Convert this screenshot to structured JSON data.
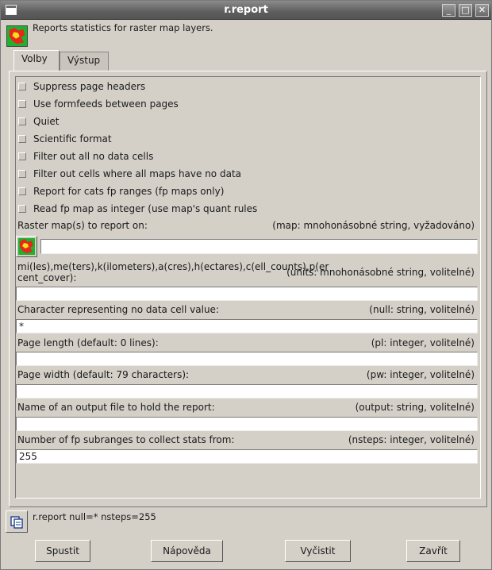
{
  "window": {
    "title": "r.report"
  },
  "header": {
    "description": "Reports statistics for raster map layers."
  },
  "tabs": [
    {
      "label": "Volby"
    },
    {
      "label": "Výstup"
    }
  ],
  "flags": [
    {
      "label": "Suppress page headers"
    },
    {
      "label": "Use formfeeds between pages"
    },
    {
      "label": "Quiet"
    },
    {
      "label": "Scientific format"
    },
    {
      "label": "Filter out all no data cells"
    },
    {
      "label": "Filter out cells where all maps have no data"
    },
    {
      "label": "Report for cats fp ranges (fp maps only)"
    },
    {
      "label": "Read fp map as integer (use map's quant rules"
    }
  ],
  "options": {
    "map": {
      "label": "Raster map(s) to report on:",
      "hint": "(map: mnohonásobné string, vyžadováno)",
      "value": ""
    },
    "units": {
      "label_line1": "mi(les),me(ters),k(ilometers),a(cres),h(ectares),c(ell_counts),p(er",
      "label_line2": "cent_cover):",
      "hint": "(units: mnohonásobné string, volitelné)",
      "value": ""
    },
    "null": {
      "label": "Character representing no data cell value:",
      "hint": "(null:  string, volitelné)",
      "value": "*"
    },
    "pl": {
      "label": "Page length (default: 0 lines):",
      "hint": "(pl:  integer, volitelné)",
      "value": ""
    },
    "pw": {
      "label": "Page width (default: 79 characters):",
      "hint": "(pw:  integer, volitelné)",
      "value": ""
    },
    "output": {
      "label": "Name of an output file to hold the report:",
      "hint": "(output:  string, volitelné)",
      "value": ""
    },
    "nsteps": {
      "label": "Number of fp subranges to collect stats from:",
      "hint": "(nsteps:  integer, volitelné)",
      "value": "255"
    }
  },
  "command": {
    "text": "r.report null=* nsteps=255"
  },
  "buttons": {
    "run": "Spustit",
    "help": "Nápověda",
    "clear": "Vyčistit",
    "close": "Zavřít"
  },
  "icons": {
    "header": "grass-raster-icon",
    "map_select": "grass-raster-icon",
    "copy": "copy-icon"
  }
}
